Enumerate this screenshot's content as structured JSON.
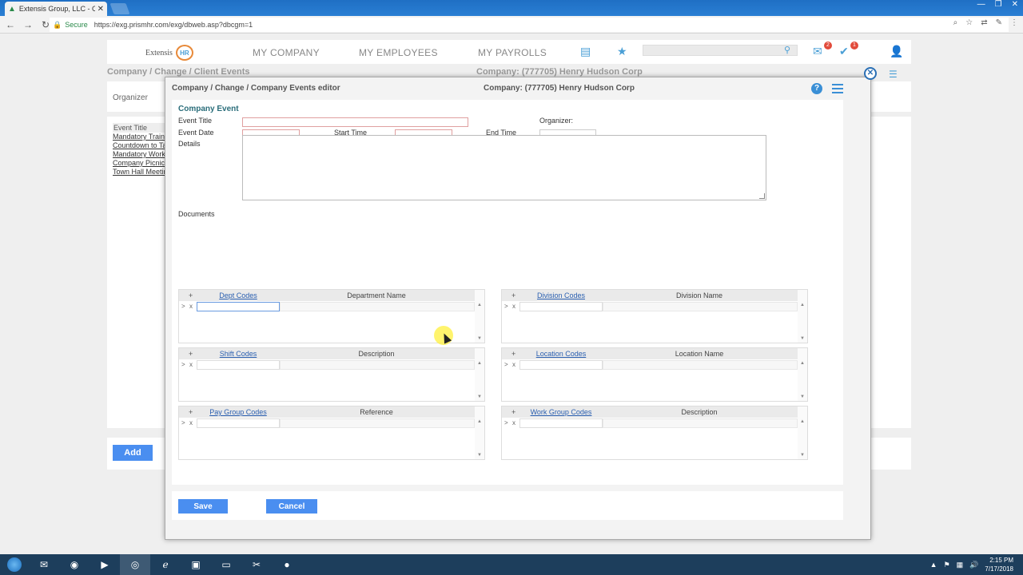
{
  "browser": {
    "tab_title": "Extensis Group, LLC - Co",
    "secure_label": "Secure",
    "url": "https://exg.prismhr.com/exg/dbweb.asp?dbcgm=1"
  },
  "header": {
    "logo_text": "Extensis",
    "logo_badge": "HR",
    "nav": [
      "MY COMPANY",
      "MY EMPLOYEES",
      "MY PAYROLLS"
    ],
    "mail_count": "2",
    "tasks_count": "1"
  },
  "background": {
    "breadcrumb": "Company / Change / Client Events",
    "company": "Company: (777705) Henry Hudson Corp",
    "organizer_label": "Organizer",
    "list_header": "Event Title",
    "events": [
      "Mandatory Training",
      "Countdown to Tax",
      "Mandatory Workshop",
      "Company Picnic",
      "Town Hall Meeting"
    ],
    "add_label": "Add"
  },
  "modal": {
    "breadcrumb": "Company / Change / Company Events editor",
    "company": "Company: (777705) Henry Hudson Corp",
    "help": "?",
    "section_title": "Company Event",
    "labels": {
      "event_title": "Event Title",
      "event_date": "Event Date",
      "start_time": "Start Time",
      "end_time": "End Time",
      "organizer": "Organizer:",
      "details": "Details",
      "documents": "Documents"
    },
    "grids": [
      {
        "code": "Dept Codes",
        "name": "Department Name"
      },
      {
        "code": "Division Codes",
        "name": "Division Name"
      },
      {
        "code": "Shift Codes",
        "name": "Description"
      },
      {
        "code": "Location Codes",
        "name": "Location Name"
      },
      {
        "code": "Pay Group Codes",
        "name": "Reference"
      },
      {
        "code": "Work Group Codes",
        "name": "Description"
      }
    ],
    "save_label": "Save",
    "cancel_label": "Cancel"
  },
  "taskbar": {
    "time": "2:15 PM",
    "date": "7/17/2018"
  }
}
